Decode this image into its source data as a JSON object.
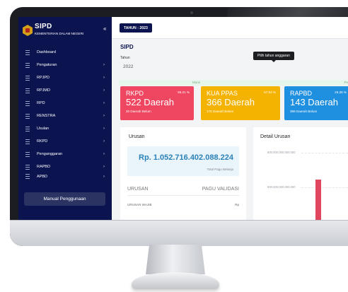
{
  "sidebar": {
    "brand": {
      "title": "SIPD",
      "subtitle": "KEMENTERIAN DALAM NEGERI",
      "toggle": "«"
    },
    "items": [
      {
        "label": "Dashboard",
        "chevron": ""
      },
      {
        "label": "Pengaturan",
        "chevron": "›"
      },
      {
        "label": "RPJPD",
        "chevron": "›"
      },
      {
        "label": "RPJMD",
        "chevron": "›"
      },
      {
        "label": "RPD",
        "chevron": "›"
      },
      {
        "label": "RENSTRA",
        "chevron": "›"
      },
      {
        "label": "Usulan",
        "chevron": "›"
      },
      {
        "label": "RKPD",
        "chevron": "›"
      },
      {
        "label": "Penganggaran",
        "chevron": "›"
      },
      {
        "label": "RAPBD",
        "chevron": "›"
      },
      {
        "label": "APBD",
        "chevron": "›"
      }
    ],
    "manual_button": "Manual Penggunaan"
  },
  "topbar": {
    "year_button": "TAHUN : 2023"
  },
  "main": {
    "title": "SIPD",
    "tahun_label": "Tahun",
    "tahun_value": "2022",
    "tooltip": "Pilih tahun anggaran",
    "band": {
      "left": "Murni",
      "right": "Pe"
    }
  },
  "stats": [
    {
      "title": "RKPD",
      "pct": "96.31 %",
      "count": "522 Daerah",
      "sub": "20 Daerah Belum",
      "color": "#ef4761"
    },
    {
      "title": "KUA PPAS",
      "pct": "67.53 %",
      "count": "366 Daerah",
      "sub": "176 Daerah Belum",
      "color": "#f5b301"
    },
    {
      "title": "RAPBD",
      "pct": "26.38 %",
      "count": "143 Daerah",
      "sub": "399 Daerah Belum",
      "color": "#1f8fe0"
    }
  ],
  "urusan": {
    "title": "Urusan",
    "total": "Rp. 1.052.716.402.088.224",
    "total_sub": "Total Pagu Belanja",
    "col_left": "URUSAN",
    "col_right": "PAGU VALIDASI",
    "row_left": "URUSAN WAJIB",
    "row_right": "Rp"
  },
  "detail": {
    "title": "Detail Urusan",
    "axis_labels": [
      "800.000.000.000.000",
      "600.000.000.000.000"
    ]
  }
}
